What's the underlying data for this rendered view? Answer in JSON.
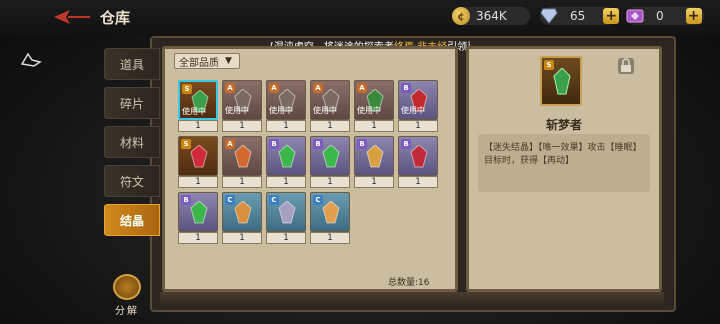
{
  "header": {
    "title": "仓库",
    "coins": "364K",
    "gems": "65",
    "tickets": "0"
  },
  "marquee": {
    "pre": "[混沌虚空、将迷途的探索者",
    "hl": "终焉·非未经",
    "post": "引领至寒雾"
  },
  "tabs": [
    {
      "label": "道具",
      "active": false
    },
    {
      "label": "碎片",
      "active": false
    },
    {
      "label": "材料",
      "active": false
    },
    {
      "label": "符文",
      "active": false
    },
    {
      "label": "结晶",
      "active": true
    }
  ],
  "decompose_label": "分解",
  "filter_label": "全部品质",
  "items": [
    {
      "q": "S",
      "count": "1",
      "in_use": "使用中",
      "color": "#3aa04a",
      "selected": true
    },
    {
      "q": "A",
      "count": "1",
      "in_use": "使用中",
      "color": "#7a6a60"
    },
    {
      "q": "A",
      "count": "1",
      "in_use": "使用中",
      "color": "#7a6a60"
    },
    {
      "q": "A",
      "count": "1",
      "in_use": "使用中",
      "color": "#7a6a60"
    },
    {
      "q": "A",
      "count": "1",
      "in_use": "使用中",
      "color": "#3a8a3e"
    },
    {
      "q": "B",
      "count": "1",
      "in_use": "使用中",
      "color": "#c02a2a"
    },
    {
      "q": "S",
      "count": "1",
      "in_use": "",
      "color": "#d02a3a"
    },
    {
      "q": "A",
      "count": "1",
      "in_use": "",
      "color": "#d26a30"
    },
    {
      "q": "B",
      "count": "1",
      "in_use": "",
      "color": "#3ab84a"
    },
    {
      "q": "B",
      "count": "1",
      "in_use": "",
      "color": "#3ab84a"
    },
    {
      "q": "B",
      "count": "1",
      "in_use": "",
      "color": "#d8a040"
    },
    {
      "q": "B",
      "count": "1",
      "in_use": "",
      "color": "#c02a3a"
    },
    {
      "q": "B",
      "count": "1",
      "in_use": "",
      "color": "#3ab84a"
    },
    {
      "q": "C",
      "count": "1",
      "in_use": "",
      "color": "#d89040"
    },
    {
      "q": "C",
      "count": "1",
      "in_use": "",
      "color": "#a8a0c0"
    },
    {
      "q": "C",
      "count": "1",
      "in_use": "",
      "color": "#e0a050"
    }
  ],
  "total_label": "总数量:16",
  "detail": {
    "name": "斩梦者",
    "quality": "S",
    "desc": "【迷失结晶】【唯一效果】攻击【睡眠】目标时，获得【再动】"
  },
  "colors": {
    "accent": "#d38a1c",
    "selection": "#38c8e8"
  }
}
